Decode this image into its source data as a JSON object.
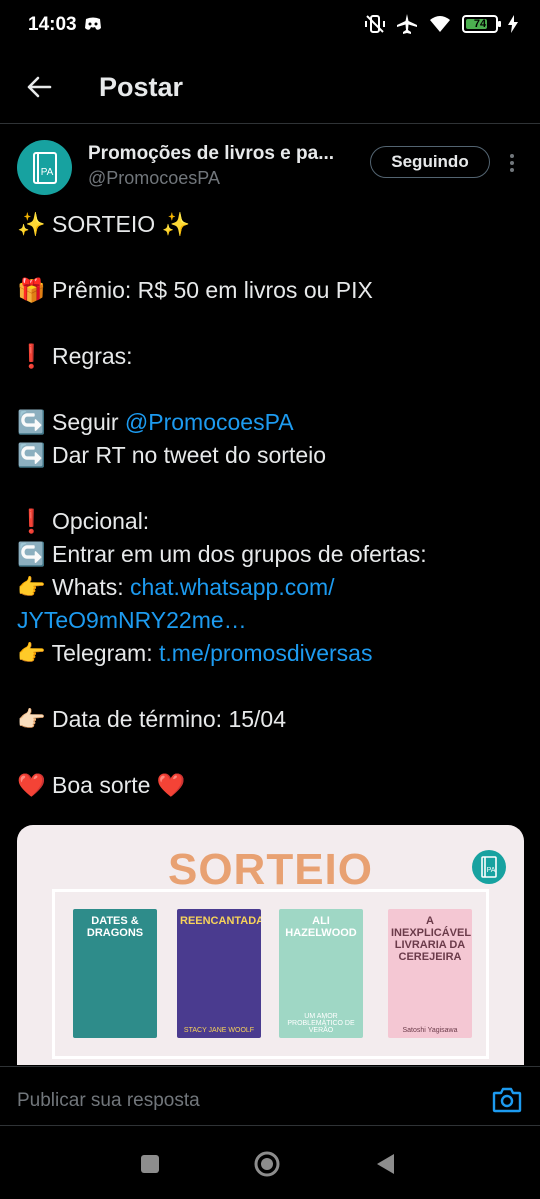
{
  "status": {
    "time": "14:03",
    "battery": "74",
    "battery_level": 0.74
  },
  "header": {
    "title": "Postar",
    "back_icon": "arrow-left-icon"
  },
  "author": {
    "name": "Promoções de livros e pa...",
    "handle": "@PromocoesPA",
    "follow_label": "Seguindo",
    "avatar_text": "PA"
  },
  "post": {
    "l1": "✨ SORTEIO ✨",
    "l2": "🎁 Prêmio: R$ 50 em livros ou PIX",
    "l3": "❗ Regras:",
    "l4_prefix": "↪️ Seguir ",
    "l4_link": "@PromocoesPA",
    "l5": "↪️ Dar RT no tweet do sorteio",
    "l6": "❗ Opcional:",
    "l7": "↪️ Entrar em um dos grupos de ofertas:",
    "l8_prefix": "👉 Whats: ",
    "l8_link": "chat.whatsapp.com/",
    "l9_link": "JYTeO9mNRY22me…",
    "l10_prefix": "👉 Telegram: ",
    "l10_link": "t.me/promosdiversas",
    "l11": "👉🏻 Data de término: 15/04",
    "l12": "❤️ Boa sorte ❤️"
  },
  "media": {
    "title": "SORTEIO",
    "logo_text": "PA",
    "books": [
      {
        "title": "DATES & DRAGONS",
        "author": "",
        "color": "#2e8c8a",
        "text_color": "#ffffff"
      },
      {
        "title": "REENCANTADA",
        "author": "STACY JANE WOOLF",
        "color": "#4a3b8f",
        "text_color": "#f7d35a"
      },
      {
        "title": "ALI HAZELWOOD",
        "author": "UM AMOR PROBLEMÁTICO DE VERÃO",
        "color": "#9fd7c5",
        "text_color": "#ffffff"
      },
      {
        "title": "A INEXPLICÁVEL LIVRARIA DA CEREJEIRA",
        "author": "Satoshi Yagisawa",
        "color": "#f4c7d3",
        "text_color": "#6b3b4a"
      }
    ]
  },
  "reply": {
    "placeholder": "Publicar sua resposta",
    "camera_icon": "camera-icon"
  },
  "colors": {
    "link": "#1d9bf0",
    "background": "#000000",
    "accent_teal": "#17a2a0",
    "sorteio_orange": "#e8a172"
  }
}
